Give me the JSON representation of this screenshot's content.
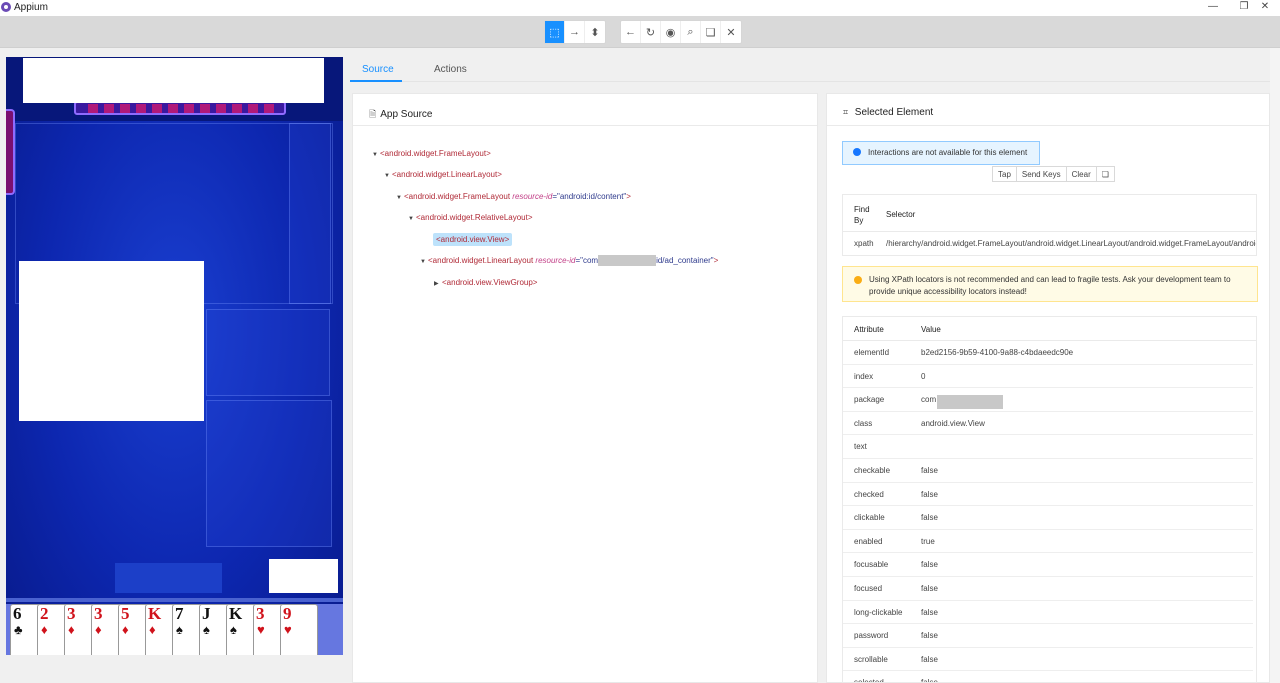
{
  "window": {
    "title": "Appium",
    "minimize": "—",
    "restore": "❐",
    "close": "✕"
  },
  "toolbar": {
    "mode_buttons": [
      "⬚",
      "→",
      "⬍"
    ],
    "nav_buttons": [
      "←",
      "↻",
      "◉",
      "⌕",
      "❏",
      "✕"
    ]
  },
  "tabs": {
    "source": "Source",
    "actions": "Actions"
  },
  "app_source": {
    "title": "App Source",
    "nodes": [
      {
        "tag": "<android.widget.FrameLayout>"
      },
      {
        "tag": "<android.widget.LinearLayout>"
      },
      {
        "tag_open": "<android.widget.FrameLayout ",
        "attr": "resource-id",
        "value": "=\"android:id/content\"",
        "tag_close": ">"
      },
      {
        "tag": "<android.widget.RelativeLayout>"
      },
      {
        "tag": "<android.view.View>"
      },
      {
        "tag_open": "<android.widget.LinearLayout ",
        "attr": "resource-id",
        "value_prefix": "=\"com",
        "value_suffix": "id/ad_container\"",
        "tag_close": ">"
      },
      {
        "tag": "<android.view.ViewGroup>"
      }
    ]
  },
  "selected_element": {
    "title": "Selected Element",
    "info_message": "Interactions are not available for this element",
    "actions": {
      "tap": "Tap",
      "send_keys": "Send Keys",
      "clear": "Clear",
      "copy": "❏"
    },
    "find_by_header": "Find By",
    "selector_header": "Selector",
    "find_by": "xpath",
    "selector": "/hierarchy/android.widget.FrameLayout/android.widget.LinearLayout/android.widget.FrameLayout/android.wi",
    "warning": "Using XPath locators is not recommended and can lead to fragile tests. Ask your development team to provide unique accessibility locators instead!",
    "attribute_header": "Attribute",
    "value_header": "Value",
    "attributes": [
      {
        "k": "elementId",
        "v": "b2ed2156-9b59-4100-9a88-c4bdaeedc90e"
      },
      {
        "k": "index",
        "v": "0"
      },
      {
        "k": "package",
        "v": "com"
      },
      {
        "k": "class",
        "v": "android.view.View"
      },
      {
        "k": "text",
        "v": ""
      },
      {
        "k": "checkable",
        "v": "false"
      },
      {
        "k": "checked",
        "v": "false"
      },
      {
        "k": "clickable",
        "v": "false"
      },
      {
        "k": "enabled",
        "v": "true"
      },
      {
        "k": "focusable",
        "v": "false"
      },
      {
        "k": "focused",
        "v": "false"
      },
      {
        "k": "long-clickable",
        "v": "false"
      },
      {
        "k": "password",
        "v": "false"
      },
      {
        "k": "scrollable",
        "v": "false"
      },
      {
        "k": "selected",
        "v": "false"
      }
    ]
  },
  "device_cards": [
    {
      "rank": "6",
      "suit": "♣",
      "color": "black"
    },
    {
      "rank": "2",
      "suit": "♦",
      "color": "red"
    },
    {
      "rank": "3",
      "suit": "♦",
      "color": "red"
    },
    {
      "rank": "3",
      "suit": "♦",
      "color": "red"
    },
    {
      "rank": "5",
      "suit": "♦",
      "color": "red"
    },
    {
      "rank": "K",
      "suit": "♦",
      "color": "red"
    },
    {
      "rank": "7",
      "suit": "♠",
      "color": "black"
    },
    {
      "rank": "J",
      "suit": "♠",
      "color": "black"
    },
    {
      "rank": "K",
      "suit": "♠",
      "color": "black"
    },
    {
      "rank": "3",
      "suit": "♥",
      "color": "red"
    },
    {
      "rank": "9",
      "suit": "♥",
      "color": "red"
    }
  ],
  "colors": {
    "accent": "#1890ff",
    "device_bg": "#0e23a8",
    "card_red": "#d0121b"
  }
}
